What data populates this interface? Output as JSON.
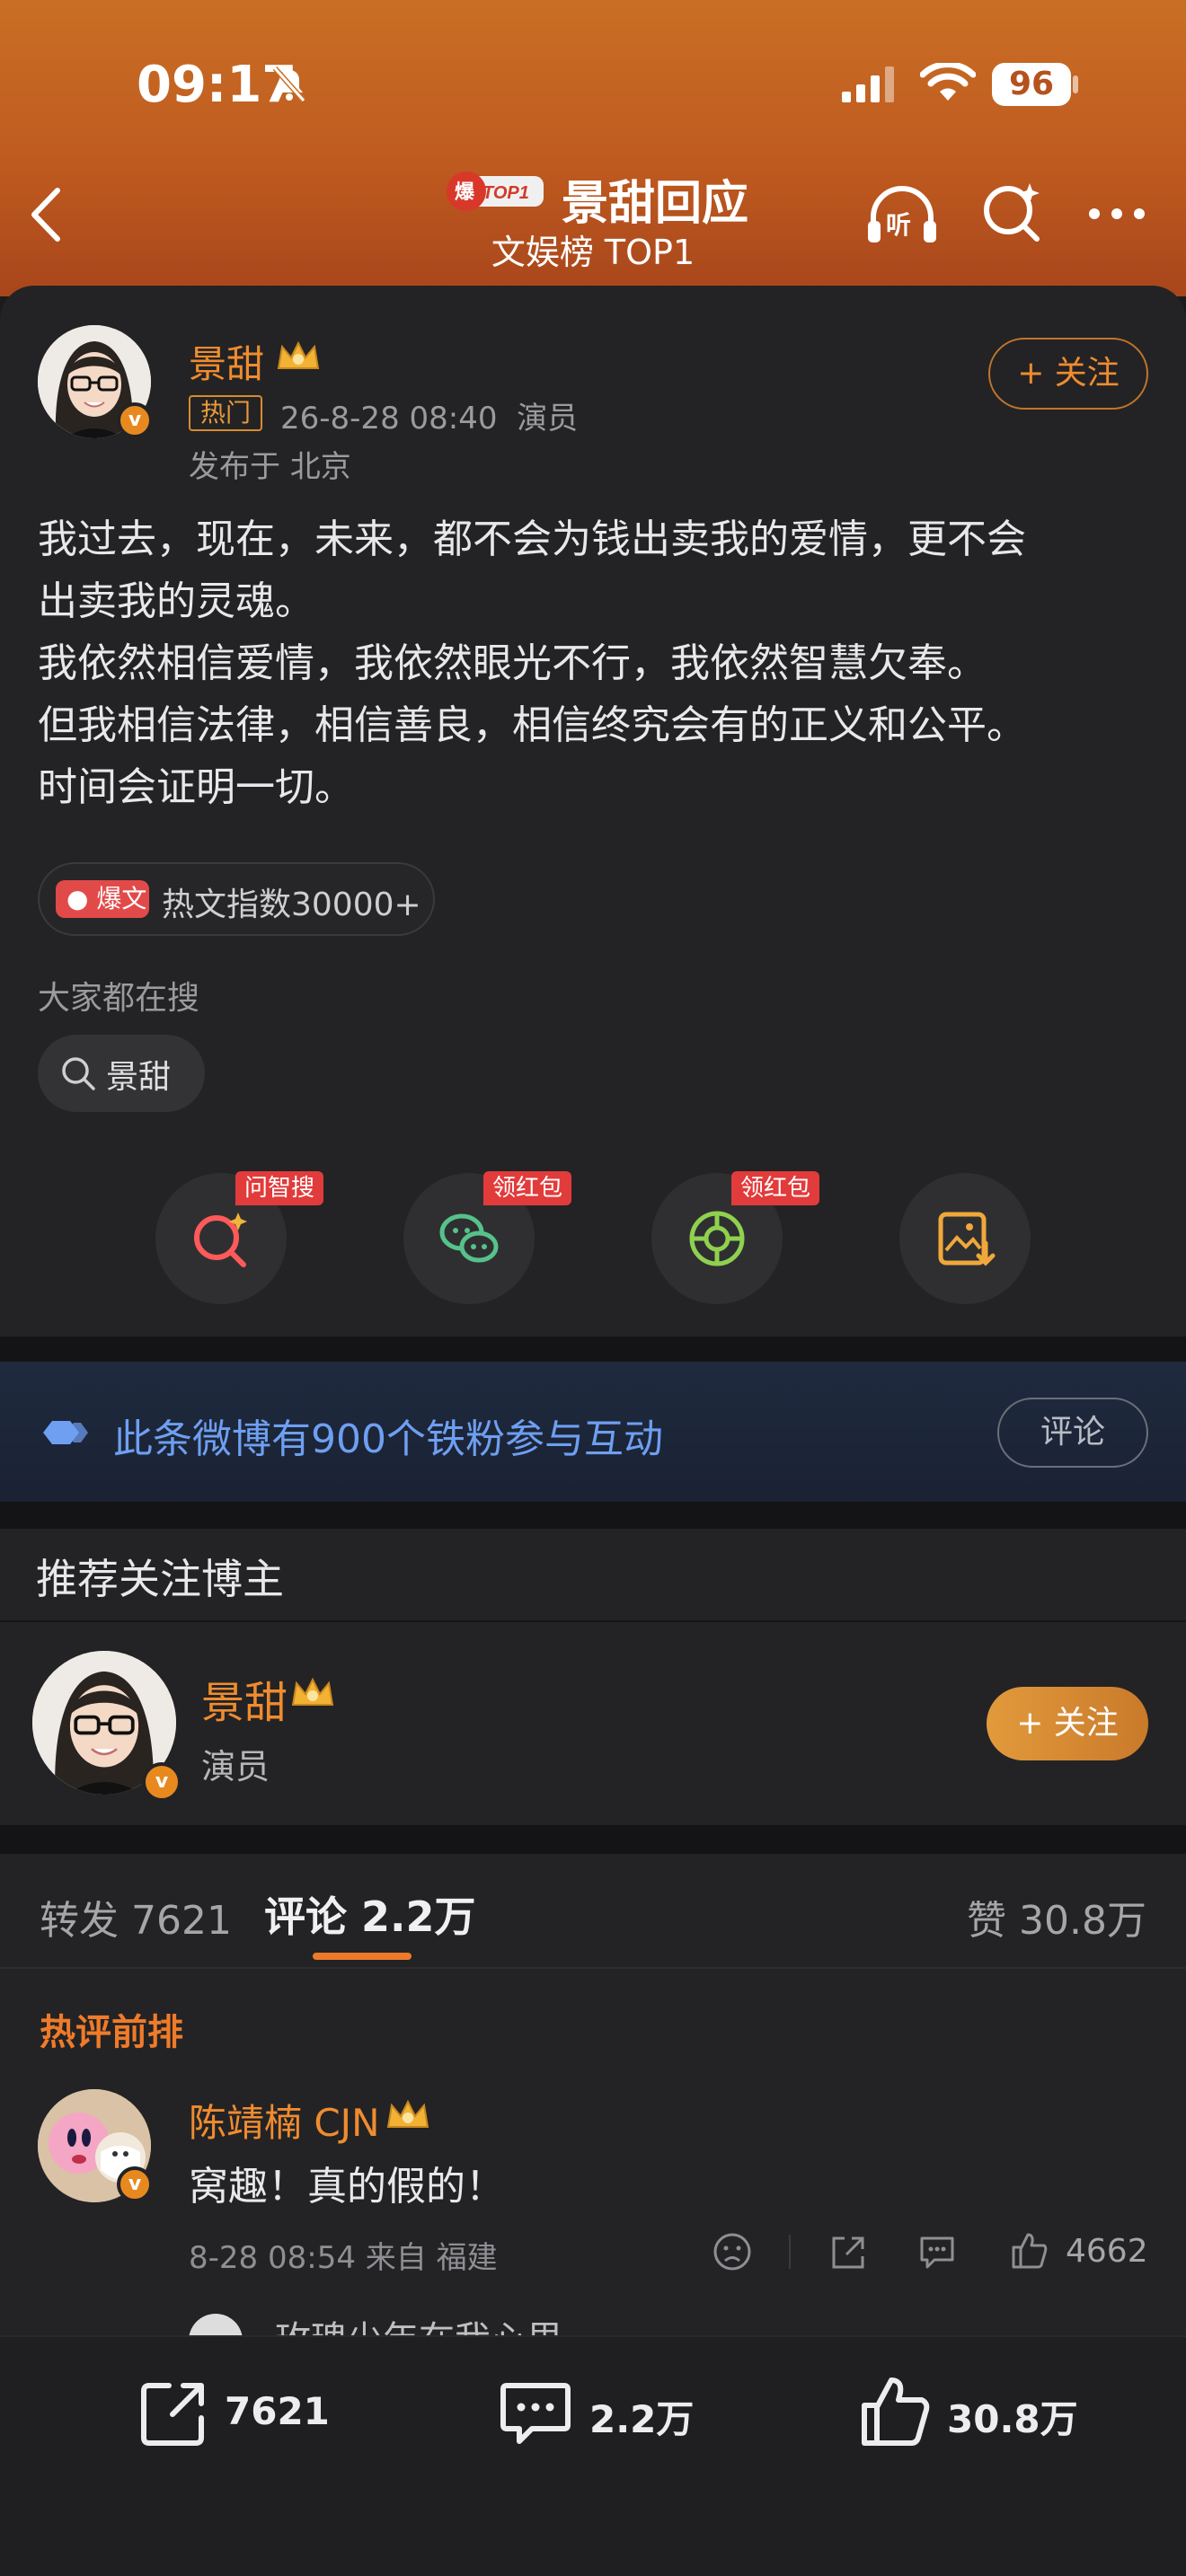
{
  "status_bar": {
    "time": "09:17",
    "battery": "96"
  },
  "header": {
    "badge_text": "爆 TOP1",
    "title": "景甜回应",
    "subtitle": "文娱榜 TOP1"
  },
  "post": {
    "author": "景甜",
    "hot_tag": "热门",
    "meta": "26-8-28 08:40  演员",
    "location": "发布于 北京",
    "follow_label": "+ 关注",
    "body_lines": [
      "我过去，现在，未来，都不会为钱出卖我的爱情，更不会",
      "出卖我的灵魂。",
      "我依然相信爱情，我依然眼光不行，我依然智慧欠奉。",
      "但我相信法律，相信善良，相信终究会有的正义和公平。",
      "时间会证明一切。"
    ],
    "hot_index": {
      "tag": "爆文",
      "text": "热文指数30000+"
    },
    "search_label": "大家都在搜",
    "search_chip": "景甜",
    "actions": [
      {
        "icon": "ai-search-icon",
        "tag": "问智搜"
      },
      {
        "icon": "wechat-icon",
        "tag": "领红包"
      },
      {
        "icon": "moments-icon",
        "tag": "领红包"
      },
      {
        "icon": "save-image-icon",
        "tag": ""
      }
    ]
  },
  "fans_banner": {
    "text": "此条微博有900个铁粉参与互动",
    "button": "评论"
  },
  "recommend": {
    "title": "推荐关注博主",
    "name": "景甜",
    "role": "演员",
    "follow_label": "+ 关注"
  },
  "tabs": {
    "repost": "转发 7621",
    "comment": "评论 2.2万",
    "like": "赞 30.8万"
  },
  "comments": {
    "section_label": "热评前排",
    "items": [
      {
        "author": "陈靖楠 CJN",
        "text": "窝趣！真的假的！",
        "meta": "8-28 08:54 来自 福建",
        "likes": "4662"
      }
    ],
    "reply_preview": "玫瑰少年在我心里"
  },
  "bottom_bar": {
    "repost": "7621",
    "comment": "2.2万",
    "like": "30.8万"
  },
  "colors": {
    "accent": "#ef8c2f",
    "header": "#c96f25",
    "link": "#6e9ff1"
  }
}
